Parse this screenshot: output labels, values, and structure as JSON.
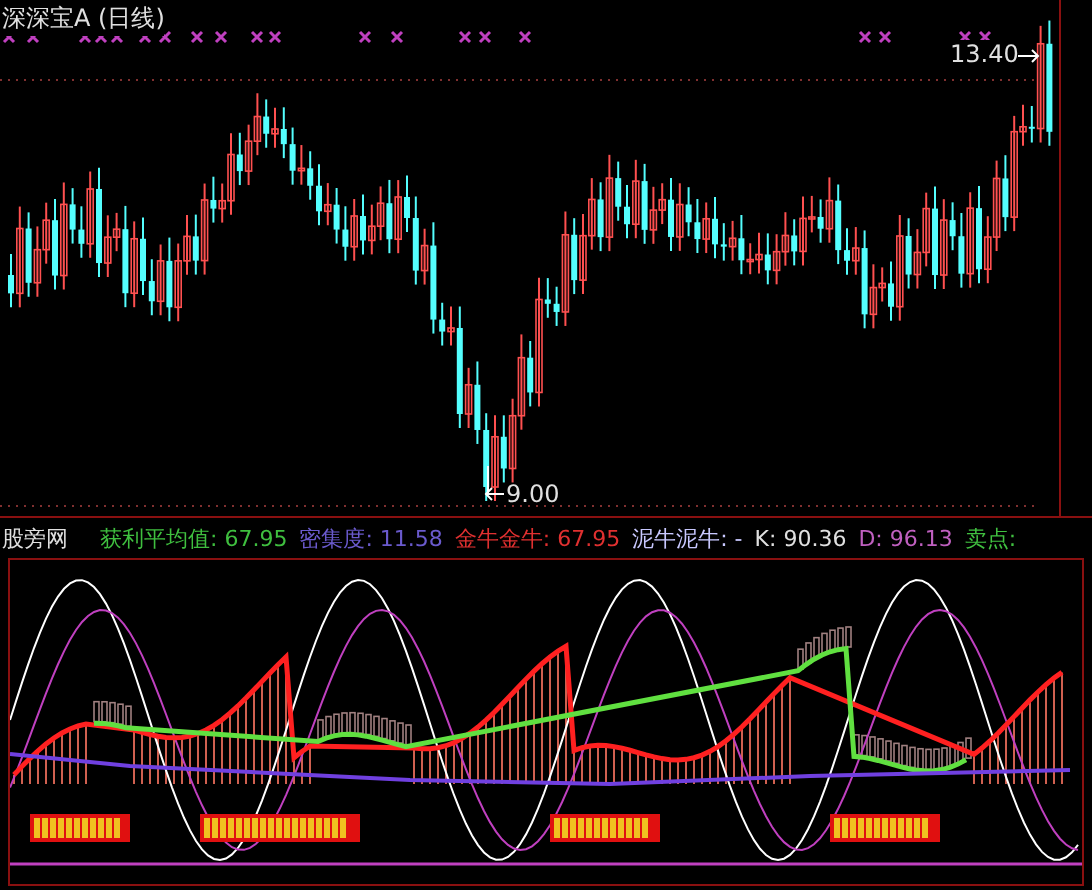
{
  "main_panel": {
    "title": "深深宝A (日线)",
    "high_label": "13.40",
    "low_label": "9.00"
  },
  "indicator_panel": {
    "name": "股旁网",
    "legend": [
      {
        "label": "获利平均值:",
        "value": "67.95",
        "color": "#3fbf3f"
      },
      {
        "label": "密集度:",
        "value": "11.58",
        "color": "#6a5acd"
      },
      {
        "label": "金牛金牛:",
        "value": "67.95",
        "color": "#e03030"
      },
      {
        "label": "泥牛泥牛:",
        "value": "-",
        "color": "#c8c8ff"
      },
      {
        "label": "K:",
        "value": "90.36",
        "color": "#e0e0e0"
      },
      {
        "label": "D:",
        "value": "96.13",
        "color": "#c060c0"
      },
      {
        "label": "卖点:",
        "color": "#40c040"
      }
    ]
  }
}
